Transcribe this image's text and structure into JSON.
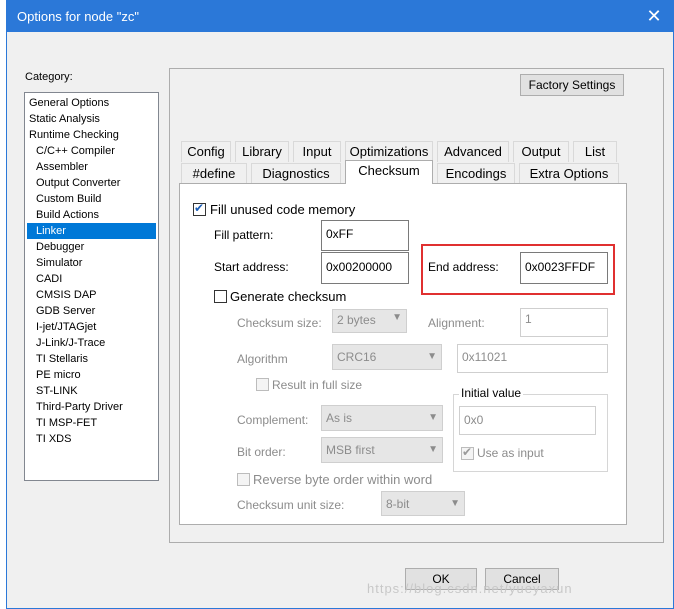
{
  "window": {
    "title": "Options for node \"zc\"",
    "close_glyph": "✕"
  },
  "category": {
    "label": "Category:",
    "items": [
      {
        "label": "General Options",
        "sub": false
      },
      {
        "label": "Static Analysis",
        "sub": false
      },
      {
        "label": "Runtime Checking",
        "sub": false
      },
      {
        "label": "C/C++ Compiler",
        "sub": true
      },
      {
        "label": "Assembler",
        "sub": true
      },
      {
        "label": "Output Converter",
        "sub": true
      },
      {
        "label": "Custom Build",
        "sub": true
      },
      {
        "label": "Build Actions",
        "sub": true
      },
      {
        "label": "Linker",
        "sub": true,
        "selected": true
      },
      {
        "label": "Debugger",
        "sub": true
      },
      {
        "label": "Simulator",
        "sub": true
      },
      {
        "label": "CADI",
        "sub": true
      },
      {
        "label": "CMSIS DAP",
        "sub": true
      },
      {
        "label": "GDB Server",
        "sub": true
      },
      {
        "label": "I-jet/JTAGjet",
        "sub": true
      },
      {
        "label": "J-Link/J-Trace",
        "sub": true
      },
      {
        "label": "TI Stellaris",
        "sub": true
      },
      {
        "label": "PE micro",
        "sub": true
      },
      {
        "label": "ST-LINK",
        "sub": true
      },
      {
        "label": "Third-Party Driver",
        "sub": true
      },
      {
        "label": "TI MSP-FET",
        "sub": true
      },
      {
        "label": "TI XDS",
        "sub": true
      }
    ]
  },
  "buttons": {
    "factory": "Factory Settings",
    "ok": "OK",
    "cancel": "Cancel"
  },
  "tabs": {
    "row1": [
      "Config",
      "Library",
      "Input",
      "Optimizations",
      "Advanced",
      "Output",
      "List"
    ],
    "row2": [
      "#define",
      "Diagnostics",
      "Checksum",
      "Encodings",
      "Extra Options"
    ],
    "active": "Checksum"
  },
  "checksum": {
    "fill_unused_label": "Fill unused code memory",
    "fill_unused_checked": true,
    "fill_pattern_label": "Fill pattern:",
    "fill_pattern_value": "0xFF",
    "start_address_label": "Start address:",
    "start_address_value": "0x00200000",
    "end_address_label": "End address:",
    "end_address_value": "0x0023FFDF",
    "generate_label": "Generate checksum",
    "generate_checked": false,
    "checksum_size_label": "Checksum size:",
    "checksum_size_value": "2 bytes",
    "alignment_label": "Alignment:",
    "alignment_value": "1",
    "algorithm_label": "Algorithm",
    "algorithm_value": "CRC16",
    "polynomial_value": "0x11021",
    "result_full_label": "Result in full size",
    "initial_value_title": "Initial value",
    "initial_value": "0x0",
    "use_as_input_label": "Use as input",
    "use_as_input_checked": true,
    "complement_label": "Complement:",
    "complement_value": "As is",
    "bit_order_label": "Bit order:",
    "bit_order_value": "MSB first",
    "reverse_label": "Reverse byte order within word",
    "unit_size_label": "Checksum unit size:",
    "unit_size_value": "8-bit"
  },
  "watermark": "https://blog.csdn.net/yueyaxun",
  "colors": {
    "titlebar": "#2b78d8",
    "selection": "#0078d7",
    "highlight": "#e03030"
  }
}
